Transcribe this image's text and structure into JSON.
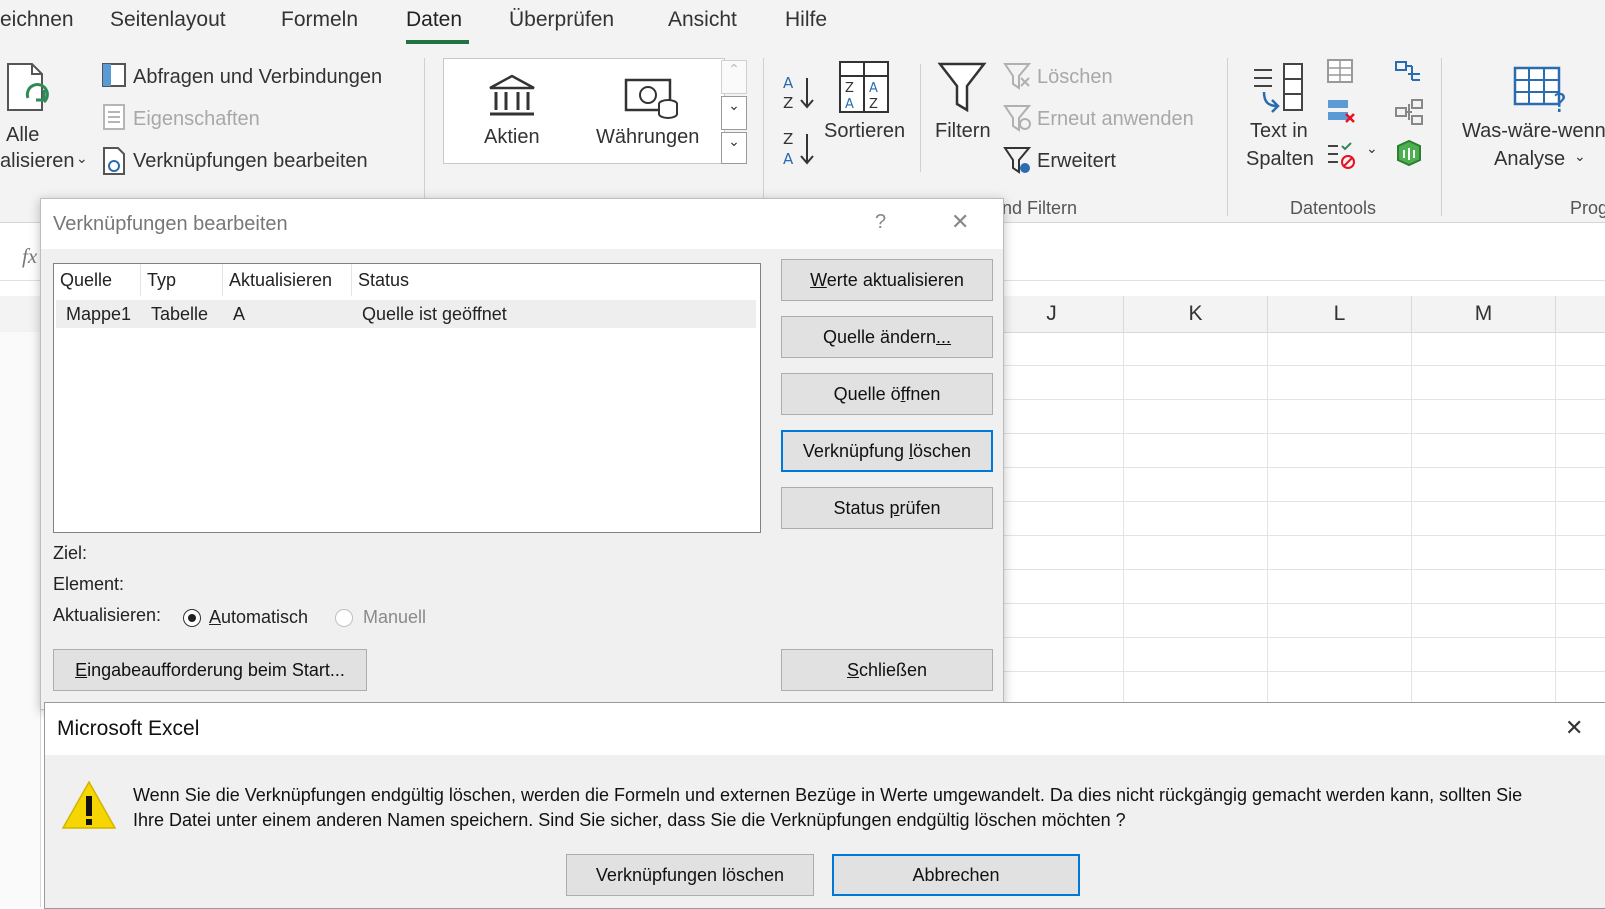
{
  "ribbon": {
    "tabs": [
      "eichnen",
      "Seitenlayout",
      "Formeln",
      "Daten",
      "Überprüfen",
      "Ansicht",
      "Hilfe"
    ],
    "active_tab": "Daten",
    "refresh_all": {
      "line1": "Alle",
      "line2": "alisieren"
    },
    "queries_connections": "Abfragen und Verbindungen",
    "properties": "Eigenschaften",
    "edit_links": "Verknüpfungen bearbeiten",
    "datatype_stocks": "Aktien",
    "datatype_currencies": "Währungen",
    "sort": "Sortieren",
    "filter": "Filtern",
    "clear": "Löschen",
    "reapply": "Erneut anwenden",
    "advanced": "Erweitert",
    "group_sort_filter": "nd Filtern",
    "text_to_columns": {
      "line1": "Text in",
      "line2": "Spalten"
    },
    "group_datatools": "Datentools",
    "whatif": {
      "line1": "Was-wäre-wenn",
      "line2": "Analyse"
    },
    "group_forecast": "Prog",
    "accent_color": "#217346"
  },
  "formula_bar": {
    "fx": "fx"
  },
  "sheet": {
    "columns": [
      "J",
      "K",
      "L",
      "M"
    ]
  },
  "edit_links_dialog": {
    "title": "Verknüpfungen bearbeiten",
    "help": "?",
    "close": "✕",
    "columns": [
      "Quelle",
      "Typ",
      "Aktualisieren",
      "Status"
    ],
    "rows": [
      {
        "source": "Mappe1",
        "type": "Tabelle",
        "update": "A",
        "status": "Quelle ist geöffnet"
      }
    ],
    "buttons": {
      "update_values": {
        "u": "W",
        "rest": "erte aktualisieren"
      },
      "change_source": {
        "pre": "Quelle ändern",
        "u": "...",
        "rest": ""
      },
      "open_source": {
        "pre": "Quelle ö",
        "u": "f",
        "rest": "fnen"
      },
      "break_link": {
        "pre": "Verknüpfung ",
        "u": "l",
        "rest": "öschen"
      },
      "check_status": {
        "pre": "Status ",
        "u": "p",
        "rest": "rüfen"
      },
      "startup_prompt": {
        "u": "E",
        "rest": "ingabeaufforderung beim Start..."
      },
      "close": {
        "u": "S",
        "rest": "chließen"
      }
    },
    "target_label": "Ziel:",
    "element_label": "Element:",
    "update_label": "Aktualisieren:",
    "auto": {
      "u": "A",
      "rest": "utomatisch"
    },
    "manual": "Manuell"
  },
  "excel_alert": {
    "title": "Microsoft Excel",
    "close": "✕",
    "line1": "Wenn Sie die Verknüpfungen endgültig löschen, werden die Formeln und externen Bezüge in Werte umgewandelt. Da dies nicht rückgängig gemacht werden kann, sollten Sie",
    "line2": "Ihre Datei unter einem anderen Namen speichern. Sind Sie sicher, dass Sie die Verknüpfungen endgültig löschen möchten ?",
    "confirm_button": "Verknüpfungen löschen",
    "cancel_button": "Abbrechen",
    "warning_color": "#f5d600"
  }
}
